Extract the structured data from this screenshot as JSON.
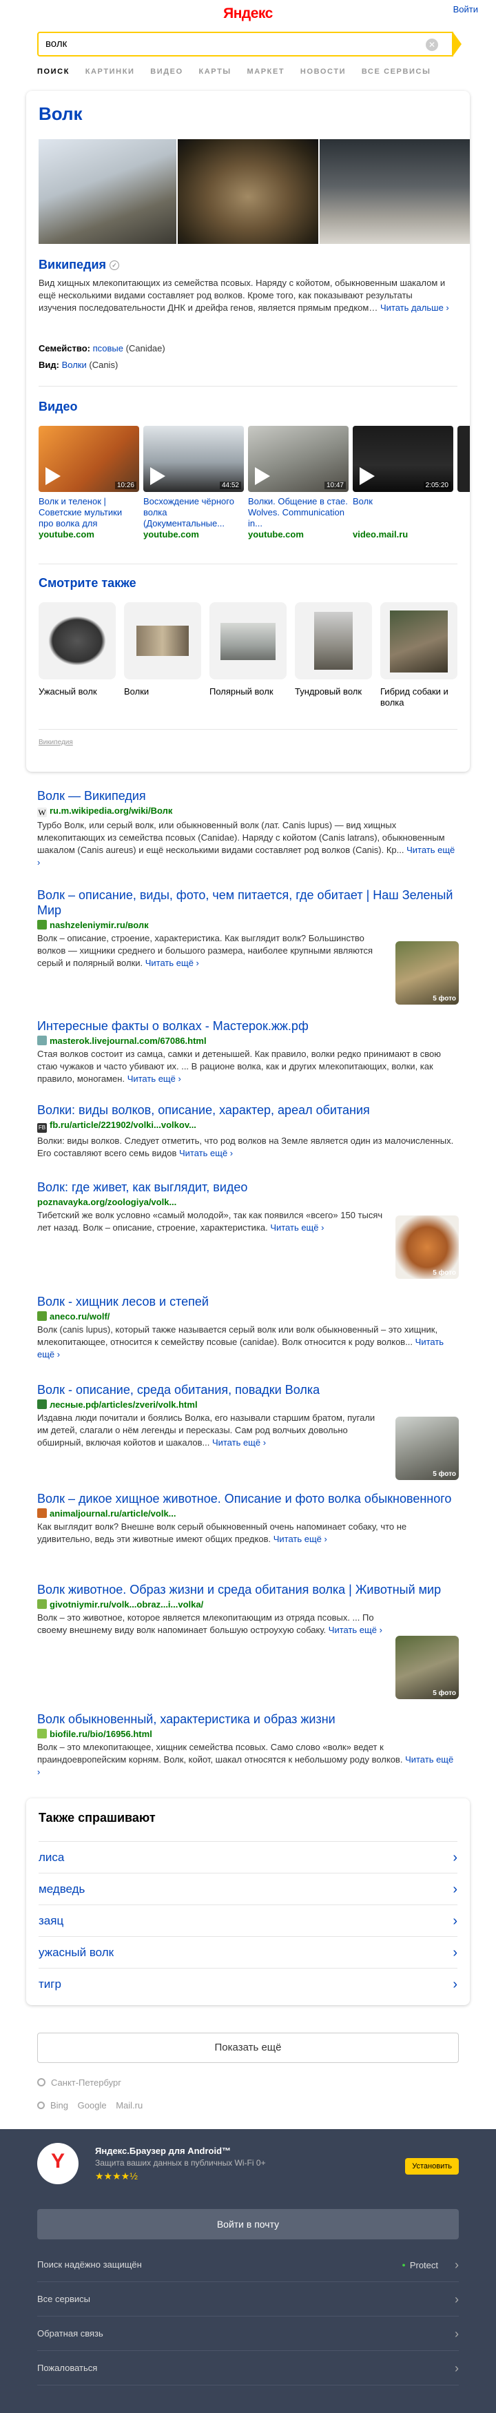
{
  "header": {
    "logo_main": "Яндекс",
    "login": "Войти"
  },
  "search": {
    "query": "волк",
    "clear": "✕"
  },
  "tabs": [
    "ПОИСК",
    "КАРТИНКИ",
    "ВИДЕО",
    "КАРТЫ",
    "МАРКЕТ",
    "НОВОСТИ",
    "ВСЕ СЕРВИСЫ"
  ],
  "wizard": {
    "title": "Волк",
    "wiki_title": "Википедия",
    "wiki_text": "Вид хищных млекопитающих из семейства псовых. Наряду с койотом, обыкновенным шакалом и ещё несколькими видами составляет род волков. Кроме того, как показывают результаты изучения последовательности ДНК и дрейфа генов, является прямым предком… ",
    "wiki_more": "Читать дальше ›",
    "family_label": "Семейство:",
    "family_value": "псовые",
    "family_latin": "(Canidae)",
    "species_label": "Вид:",
    "species_value": "Волки",
    "species_latin": "(Canis)",
    "video_title": "Видео",
    "videos": [
      {
        "title": "Волк и теленок | Советские мультики про волка для",
        "source": "youtube.com",
        "duration": "10:26"
      },
      {
        "title": "Восхождение чёрного волка (Документальные...",
        "source": "youtube.com",
        "duration": "44:52"
      },
      {
        "title": "Волки. Общение в стае. Wolves. Communication in...",
        "source": "youtube.com",
        "duration": "10:47"
      },
      {
        "title": "Волк",
        "source": "video.mail.ru",
        "duration": "2:05:20"
      }
    ],
    "see_also_title": "Смотрите также",
    "see_also": [
      "Ужасный волк",
      "Волки",
      "Полярный волк",
      "Тундровый волк",
      "Гибрид собаки и волка"
    ],
    "footer": "Википедия"
  },
  "results": [
    {
      "title": "Волк — Википедия",
      "url": "ru.m.wikipedia.org/wiki/Волк",
      "text": "Турбо  Волк, или серый волк, или обыкновенный волк (лат. Canis lupus) — вид хищных млекопитающих из семейства псовых (Canidae). Наряду с койотом (Canis latrans), обыкновенным шакалом (Canis aureus) и ещё несколькими видами составляет род волков (Canis). Кр... ",
      "more": "Читать ещё ›"
    },
    {
      "title": "Волк – описание, виды, фото, чем питается, где обитает | Наш Зеленый Мир",
      "url": "nashzeleniymir.ru/волк",
      "text": "Волк – описание, строение, характеристика. Как выглядит волк? Большинство волков — хищники среднего и большого размера, наиболее крупными являются серый и полярный волки. ",
      "more": "Читать ещё ›",
      "photo": "5 фото"
    },
    {
      "title": "Интересные факты о волках - Мастерок.жж.рф",
      "url": "masterok.livejournal.com/67086.html",
      "text": "Стая волков состоит из самца, самки и детенышей. Как правило, волки редко принимают в свою стаю чужаков и часто убивают их. ... В рационе волка, как и других млекопитающих, волки, как правило, моногамен. ",
      "more": "Читать ещё ›"
    },
    {
      "title": "Волки: виды волков, описание, характер, ареал обитания",
      "url": "fb.ru/article/221902/volki...volkov...",
      "text": "Волки: виды волков. Следует отметить, что род волков на Земле является один из малочисленных. Его составляют всего семь видов ",
      "more": "Читать ещё ›"
    },
    {
      "title": "Волк: где живет, как выглядит, видео",
      "url": "poznavayka.org/zoologiya/volk...",
      "text": "Тибетский же волк условно «самый молодой», так как появился «всего» 150 тысяч лет назад. Волк – описание, строение, характеристика. ",
      "more": "Читать ещё ›",
      "photo": "5 фото"
    },
    {
      "title": "Волк - хищник лесов и степей",
      "url": "aneco.ru/wolf/",
      "text": "Волк (canis lupus), который также называется серый волк или волк обыкновенный – это хищник, млекопитающее, относится к семейству псовые (canidae). Волк относится к роду волков... ",
      "more": "Читать ещё ›"
    },
    {
      "title": "Волк - описание, среда обитания, повадки Волка",
      "url": "лесные.рф/articles/zveri/volk.html",
      "text": "Издавна люди почитали и боялись Волка, его называли старшим братом, пугали им детей, слагали о нём легенды и пересказы. Сам род волчьих довольно обширный, включая койотов и шакалов... ",
      "more": "Читать ещё ›",
      "photo": "5 фото"
    },
    {
      "title": "Волк – дикое хищное животное. Описание и фото волка обыкновенного",
      "url": "animaljournal.ru/article/volk...",
      "text": "Как выглядит волк? Внешне волк серый обыкновенный очень напоминает собаку, что не удивительно, ведь эти животные имеют общих предков. ",
      "more": "Читать ещё ›"
    },
    {
      "title": "Волк животное. Образ жизни и среда обитания волка | Животный мир",
      "url": "givotniymir.ru/volk...obraz...i...volka/",
      "text": "Волк – это животное, которое является млекопитающим из отряда псовых. ... По своему внешнему виду волк напоминает большую остроухую собаку. ",
      "more": "Читать ещё ›",
      "photo": "5 фото"
    },
    {
      "title": "Волк обыкновенный, характеристика и образ жизни",
      "url": "biofile.ru/bio/16956.html",
      "text": "Волк – это млекопитающее, хищник семейства псовых. Само слово «волк» ведет к праиндоевропейским корням. Волк, койот, шакал относятся к небольшому роду волков. ",
      "more": "Читать ещё ›"
    }
  ],
  "also_ask": {
    "title": "Также спрашивают",
    "items": [
      "лиса",
      "медведь",
      "заяц",
      "ужасный волк",
      "тигр"
    ]
  },
  "more_button": "Показать ещё",
  "region": "Санкт-Петербург",
  "engines": [
    "Bing",
    "Google",
    "Mail.ru"
  ],
  "footer": {
    "promo_title": "Яндекс.Браузер для Android™",
    "promo_sub": "Защита ваших данных в публичных Wi-Fi",
    "promo_age": "0+",
    "promo_stars": "★★★★½",
    "promo_button": "Установить",
    "login_button": "Войти в почту",
    "links": [
      "Поиск надёжно защищён",
      "Все сервисы",
      "Обратная связь",
      "Пожаловаться"
    ],
    "protect": "Protect"
  },
  "colors": {
    "accent": "#ffcc00",
    "link": "#0044bb",
    "url": "#007700",
    "dark": "#3a4457"
  }
}
